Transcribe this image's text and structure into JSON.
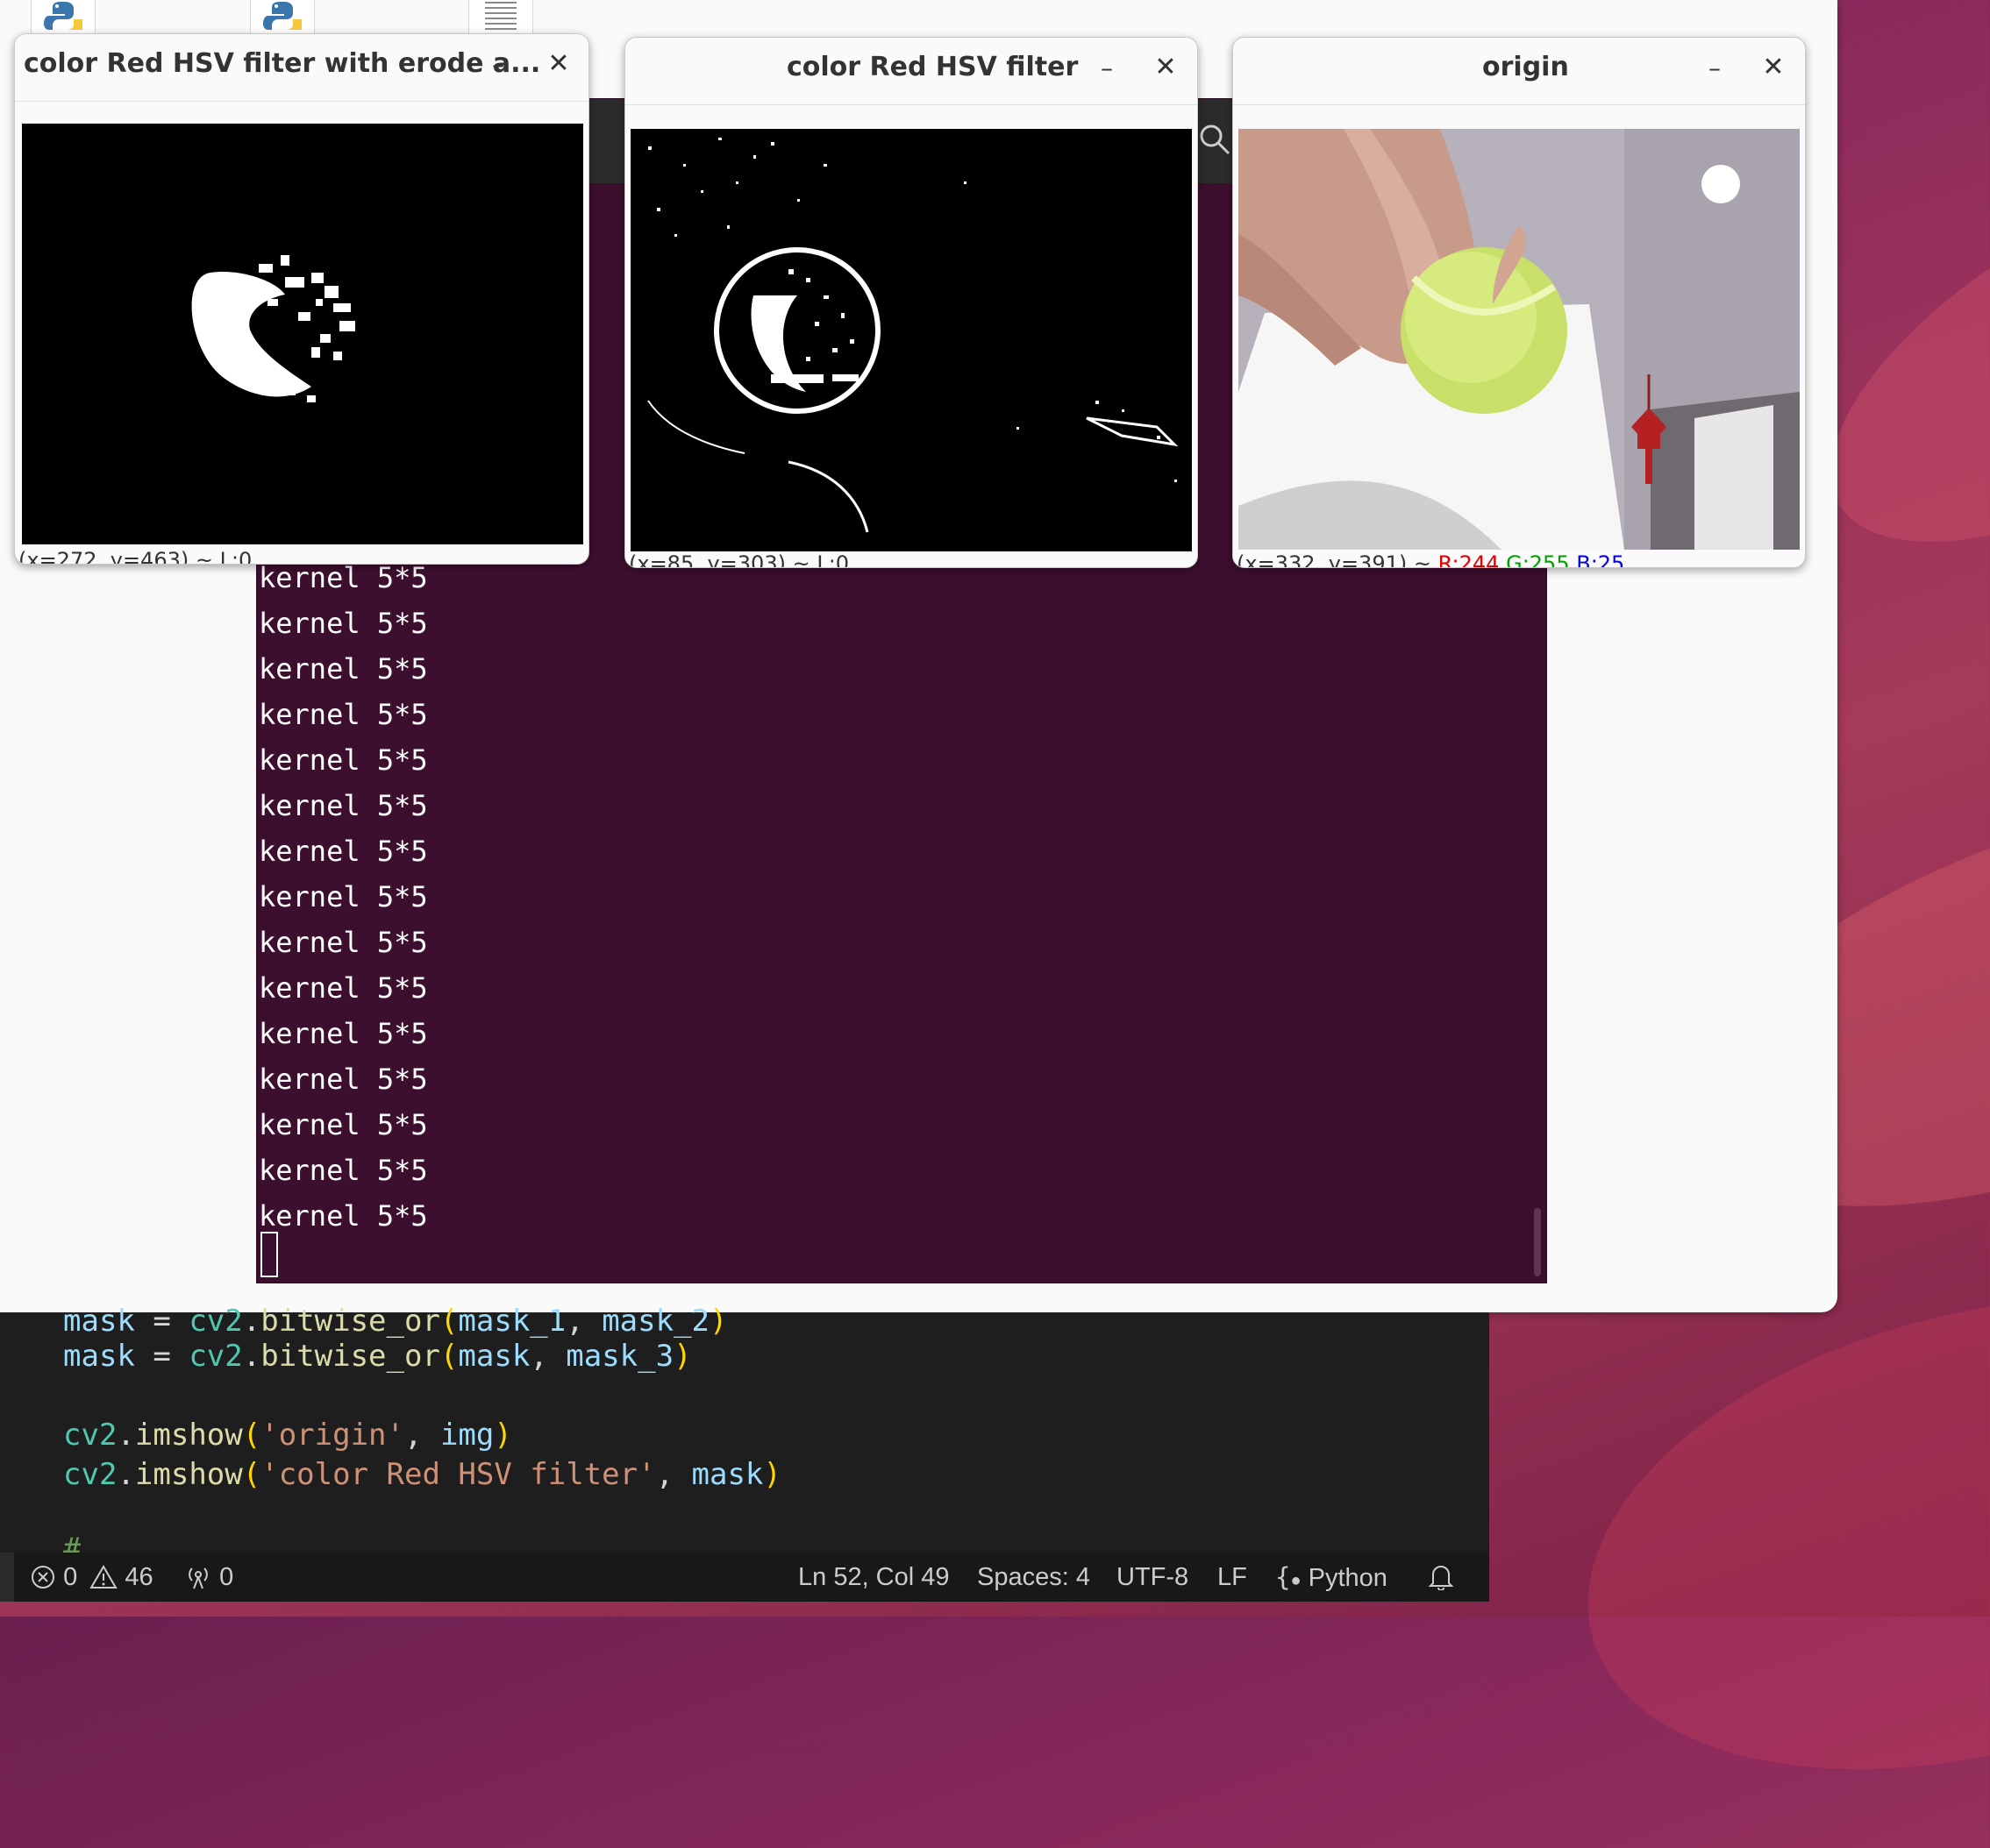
{
  "desktop": {
    "accent": "#8c2a5c"
  },
  "terminal": {
    "lines": [
      "kernel 5*5",
      "kernel 5*5",
      "kernel 5*5",
      "kernel 5*5",
      "kernel 5*5",
      "kernel 5*5",
      "kernel 5*5",
      "kernel 5*5",
      "kernel 5*5",
      "kernel 5*5",
      "kernel 5*5",
      "kernel 5*5",
      "kernel 5*5",
      "kernel 5*5",
      "kernel 5*5"
    ]
  },
  "editor": {
    "line0": {
      "a": "mask",
      "b": " = ",
      "c": "cv2",
      "d": ".",
      "e": "bitwise_or",
      "f": "(",
      "g": "mask_1",
      "h": ", ",
      "i": "mask_2",
      "j": ")"
    },
    "line1": {
      "a": "mask",
      "b": " = ",
      "c": "cv2",
      "d": ".",
      "e": "bitwise_or",
      "f": "(",
      "g": "mask",
      "h": ", ",
      "i": "mask_3",
      "j": ")"
    },
    "line3": {
      "c": "cv2",
      "d": ".",
      "e": "imshow",
      "f": "(",
      "s": "'origin'",
      "h": ", ",
      "i": "img",
      "j": ")"
    },
    "line4": {
      "c": "cv2",
      "d": ".",
      "e": "imshow",
      "f": "(",
      "s": "'color Red HSV filter'",
      "h": ", ",
      "i": "mask",
      "j": ")"
    },
    "line6": "#"
  },
  "statusbar": {
    "errors": "0",
    "warnings": "46",
    "ports": "0",
    "position": "Ln 52, Col 49",
    "spaces": "Spaces: 4",
    "encoding": "UTF-8",
    "eol": "LF",
    "language": "Python"
  },
  "windows": {
    "erode": {
      "title": "color Red HSV filter with erode a...",
      "status": "(x=272, y=463) ~ L:0"
    },
    "filter": {
      "title": "color Red HSV filter",
      "status": "(x=85, y=303) ~ L:0"
    },
    "origin": {
      "title": "origin",
      "status_pos": "(x=332, y=391) ~",
      "r": "R:244",
      "g": "G:255",
      "b": "B:25"
    }
  }
}
